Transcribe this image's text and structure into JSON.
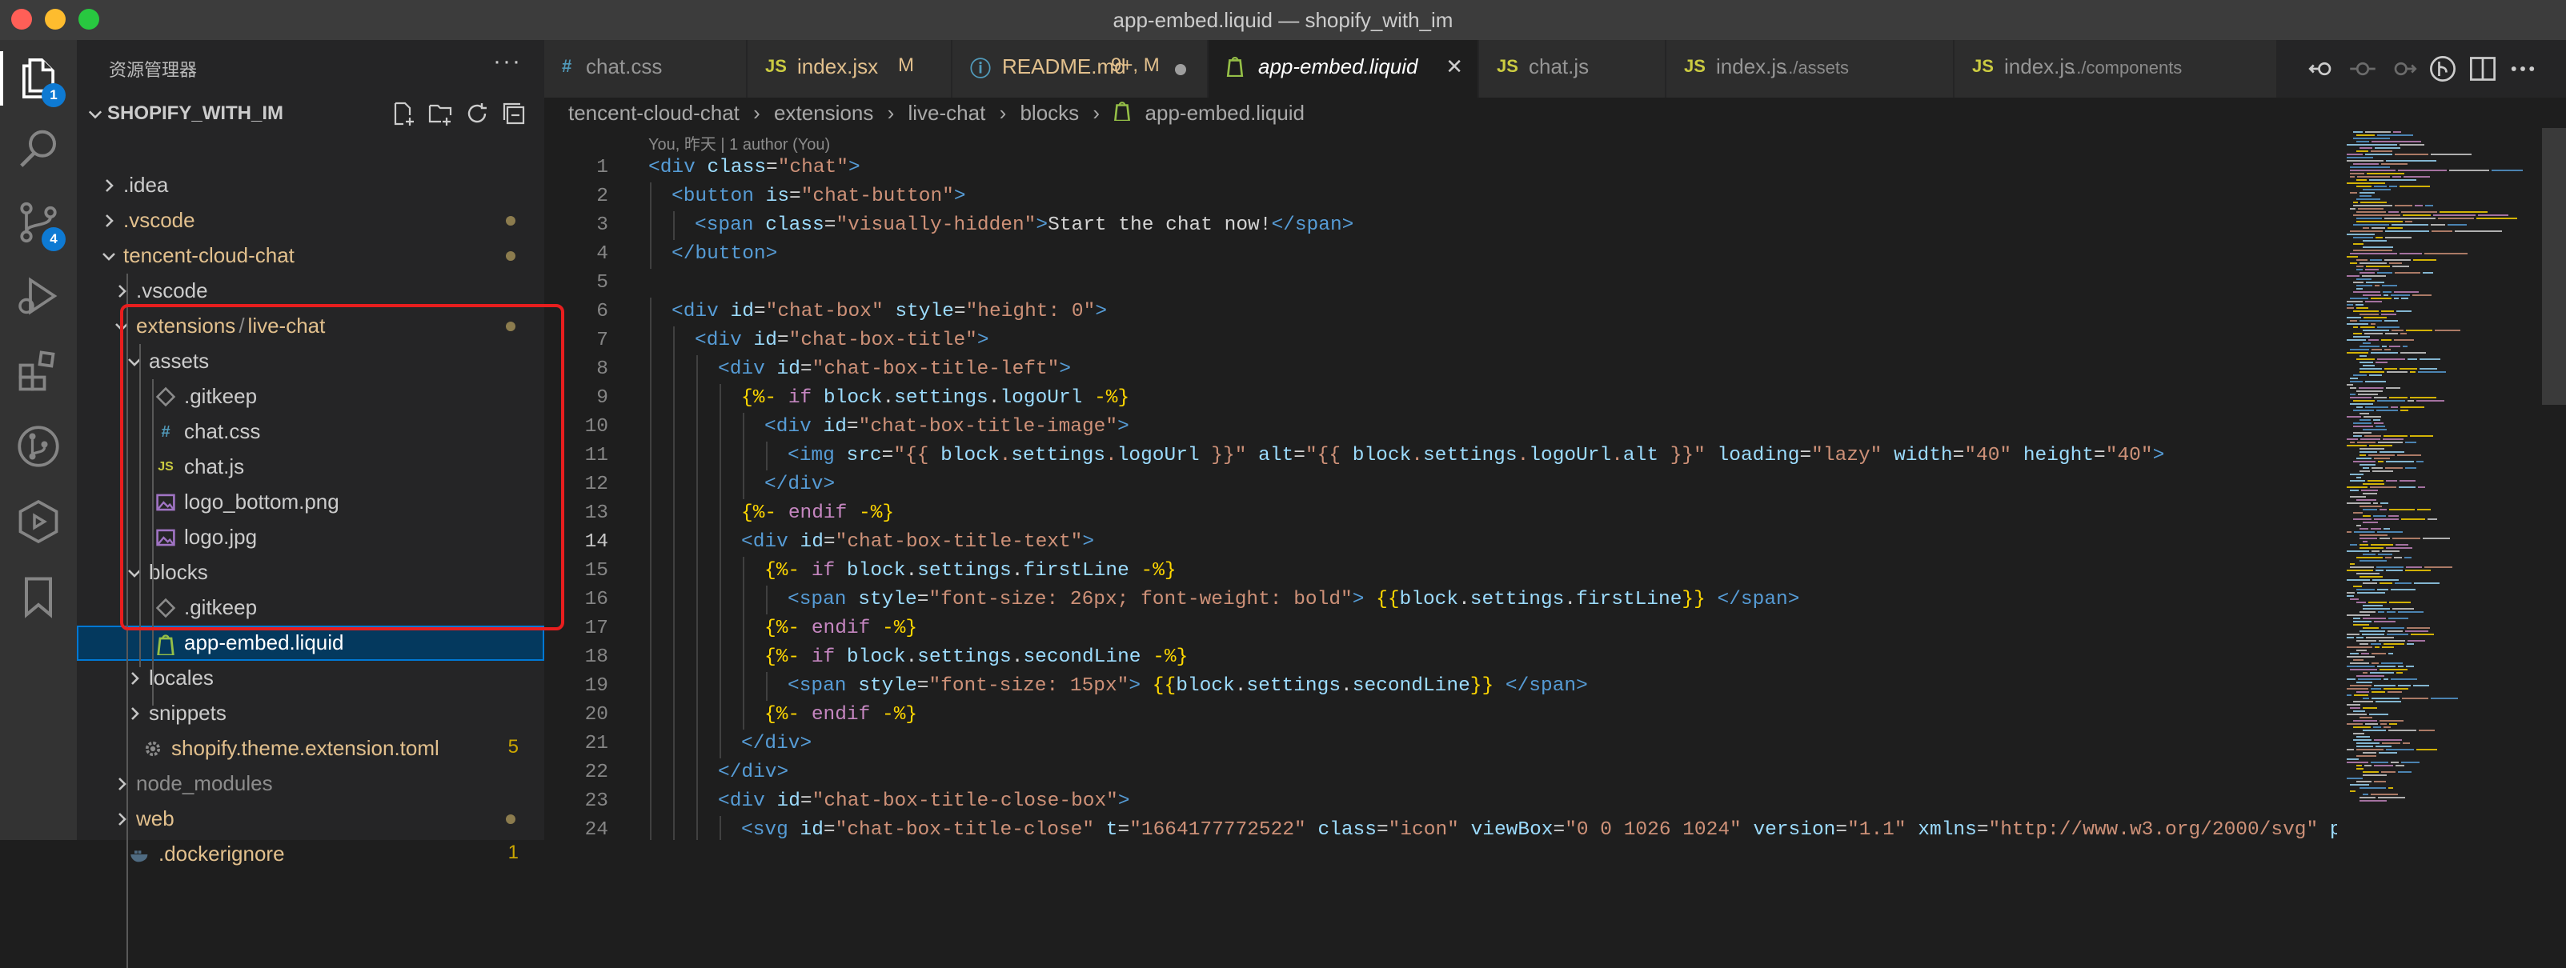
{
  "window": {
    "title": "app-embed.liquid — shopify_with_im"
  },
  "colors": {
    "accent": "#0078d4",
    "highlight_box": "#e81e1e",
    "modified": "#e2c08d",
    "git_dot": "#8c7c4e"
  },
  "activity_bar": {
    "items": [
      {
        "icon": "files-icon",
        "badge": "1"
      },
      {
        "icon": "search-icon"
      },
      {
        "icon": "source-control-icon",
        "badge": "4"
      },
      {
        "icon": "run-debug-icon"
      },
      {
        "icon": "extensions-icon"
      },
      {
        "icon": "git-graph-icon"
      },
      {
        "icon": "remote-explorer-icon"
      },
      {
        "icon": "bookmark-icon"
      }
    ]
  },
  "explorer": {
    "header": "资源管理器",
    "more": "···",
    "project": "SHOPIFY_WITH_IM",
    "tree": [
      {
        "label": ".idea",
        "chev": "right"
      },
      {
        "label": ".vscode",
        "chev": "right",
        "dot": true
      },
      {
        "label": "tencent-cloud-chat",
        "chev": "down",
        "dot": true
      },
      {
        "label": ".vscode",
        "chev": "right"
      },
      {
        "label": "extensions",
        "sep": "/",
        "label2": "live-chat",
        "chev": "down",
        "dot": true
      },
      {
        "label": "assets",
        "chev": "down"
      },
      {
        "label": ".gitkeep",
        "icon": "gitkeep-icon"
      },
      {
        "label": "chat.css",
        "icon": "css-icon",
        "glyph": "#"
      },
      {
        "label": "chat.js",
        "icon": "js-icon",
        "glyph": "JS"
      },
      {
        "label": "logo_bottom.png",
        "icon": "image-icon"
      },
      {
        "label": "logo.jpg",
        "icon": "image-icon"
      },
      {
        "label": "blocks",
        "chev": "down"
      },
      {
        "label": ".gitkeep",
        "icon": "gitkeep-icon"
      },
      {
        "label": "app-embed.liquid",
        "icon": "shopify-icon"
      },
      {
        "label": "locales",
        "chev": "right"
      },
      {
        "label": "snippets",
        "chev": "right"
      },
      {
        "label": "shopify.theme.extension.toml",
        "icon": "gear-icon",
        "count": "5"
      },
      {
        "label": "node_modules",
        "chev": "right"
      },
      {
        "label": "web",
        "chev": "right",
        "dot": true
      },
      {
        "label": ".dockerignore",
        "icon": "docker-icon",
        "count": "1"
      }
    ]
  },
  "tabs": [
    {
      "icon": "css-icon",
      "glyph": "#",
      "label": "chat.css"
    },
    {
      "icon": "js-icon",
      "glyph": "JS",
      "label": "index.jsx",
      "suffix": "M"
    },
    {
      "icon": "info-icon",
      "glyph": "ⓘ",
      "label": "README.md",
      "suffix": "9+, M"
    },
    {
      "icon": "shopify-icon",
      "label": "app-embed.liquid",
      "active": true
    },
    {
      "icon": "js-icon",
      "glyph": "JS",
      "label": "chat.js"
    },
    {
      "icon": "js-icon",
      "glyph": "JS",
      "label": "index.js",
      "suffix": ".../assets"
    },
    {
      "icon": "js-icon",
      "glyph": "JS",
      "label": "index.js",
      "suffix": ".../components"
    }
  ],
  "breadcrumb": [
    "tencent-cloud-chat",
    "extensions",
    "live-chat",
    "blocks",
    "app-embed.liquid"
  ],
  "blame": "You, 昨天 | 1 author (You)",
  "code_lines": [
    [
      [
        "t",
        "<div "
      ],
      [
        "a",
        "class"
      ],
      [
        "p",
        "="
      ],
      [
        "s",
        "\"chat\""
      ],
      [
        "t",
        ">"
      ]
    ],
    [
      [
        "t",
        "<button "
      ],
      [
        "a",
        "is"
      ],
      [
        "p",
        "="
      ],
      [
        "s",
        "\"chat-button\""
      ],
      [
        "t",
        ">"
      ]
    ],
    [
      [
        "t",
        "<span "
      ],
      [
        "a",
        "class"
      ],
      [
        "p",
        "="
      ],
      [
        "s",
        "\"visually-hidden\""
      ],
      [
        "t",
        ">"
      ],
      [
        "p",
        "Start the chat now!"
      ],
      [
        "t",
        "</span>"
      ]
    ],
    [
      [
        "t",
        "</button>"
      ]
    ],
    [],
    [
      [
        "t",
        "<div "
      ],
      [
        "a",
        "id"
      ],
      [
        "p",
        "="
      ],
      [
        "s",
        "\"chat-box\" "
      ],
      [
        "a",
        "style"
      ],
      [
        "p",
        "="
      ],
      [
        "s",
        "\"height: 0\""
      ],
      [
        "t",
        ">"
      ]
    ],
    [
      [
        "t",
        "<div "
      ],
      [
        "a",
        "id"
      ],
      [
        "p",
        "="
      ],
      [
        "s",
        "\"chat-box-title\""
      ],
      [
        "t",
        ">"
      ]
    ],
    [
      [
        "t",
        "<div "
      ],
      [
        "a",
        "id"
      ],
      [
        "p",
        "="
      ],
      [
        "s",
        "\"chat-box-title-left\""
      ],
      [
        "t",
        ">"
      ]
    ],
    [
      [
        "y",
        "{%- "
      ],
      [
        "k",
        "if "
      ],
      [
        "v",
        "block"
      ],
      [
        "p",
        "."
      ],
      [
        "v",
        "settings"
      ],
      [
        "p",
        "."
      ],
      [
        "v",
        "logoUrl "
      ],
      [
        "y",
        "-%}"
      ]
    ],
    [
      [
        "t",
        "<div "
      ],
      [
        "a",
        "id"
      ],
      [
        "p",
        "="
      ],
      [
        "s",
        "\"chat-box-title-image\""
      ],
      [
        "t",
        ">"
      ]
    ],
    [
      [
        "t",
        "<img "
      ],
      [
        "a",
        "src"
      ],
      [
        "p",
        "="
      ],
      [
        "s",
        "\"{{ "
      ],
      [
        "v",
        "block"
      ],
      [
        "s",
        "."
      ],
      [
        "v",
        "settings"
      ],
      [
        "s",
        "."
      ],
      [
        "v",
        "logoUrl"
      ],
      [
        "s",
        " }}\" "
      ],
      [
        "a",
        "alt"
      ],
      [
        "p",
        "="
      ],
      [
        "s",
        "\"{{ "
      ],
      [
        "v",
        "block"
      ],
      [
        "s",
        "."
      ],
      [
        "v",
        "settings"
      ],
      [
        "s",
        "."
      ],
      [
        "v",
        "logoUrl"
      ],
      [
        "s",
        "."
      ],
      [
        "v",
        "alt"
      ],
      [
        "s",
        " }}\" "
      ],
      [
        "a",
        "loading"
      ],
      [
        "p",
        "="
      ],
      [
        "s",
        "\"lazy\" "
      ],
      [
        "a",
        "width"
      ],
      [
        "p",
        "="
      ],
      [
        "s",
        "\"40\" "
      ],
      [
        "a",
        "height"
      ],
      [
        "p",
        "="
      ],
      [
        "s",
        "\"40\""
      ],
      [
        "t",
        ">"
      ]
    ],
    [
      [
        "t",
        "</div>"
      ]
    ],
    [
      [
        "y",
        "{%- "
      ],
      [
        "k",
        "endif "
      ],
      [
        "y",
        "-%}"
      ]
    ],
    [
      [
        "t",
        "<div "
      ],
      [
        "a",
        "id"
      ],
      [
        "p",
        "="
      ],
      [
        "s",
        "\"chat-box-title-text\""
      ],
      [
        "t",
        ">"
      ]
    ],
    [
      [
        "y",
        "{%- "
      ],
      [
        "k",
        "if "
      ],
      [
        "v",
        "block"
      ],
      [
        "p",
        "."
      ],
      [
        "v",
        "settings"
      ],
      [
        "p",
        "."
      ],
      [
        "v",
        "firstLine "
      ],
      [
        "y",
        "-%}"
      ]
    ],
    [
      [
        "t",
        "<span "
      ],
      [
        "a",
        "style"
      ],
      [
        "p",
        "="
      ],
      [
        "s",
        "\"font-size: 26px; font-weight: bold\""
      ],
      [
        "t",
        ">"
      ],
      [
        "y",
        " {{"
      ],
      [
        "v",
        "block"
      ],
      [
        "p",
        "."
      ],
      [
        "v",
        "settings"
      ],
      [
        "p",
        "."
      ],
      [
        "v",
        "firstLine"
      ],
      [
        "y",
        "}}"
      ],
      [
        "t",
        " </span>"
      ]
    ],
    [
      [
        "y",
        "{%- "
      ],
      [
        "k",
        "endif "
      ],
      [
        "y",
        "-%}"
      ]
    ],
    [
      [
        "y",
        "{%- "
      ],
      [
        "k",
        "if "
      ],
      [
        "v",
        "block"
      ],
      [
        "p",
        "."
      ],
      [
        "v",
        "settings"
      ],
      [
        "p",
        "."
      ],
      [
        "v",
        "secondLine "
      ],
      [
        "y",
        "-%}"
      ]
    ],
    [
      [
        "t",
        "<span "
      ],
      [
        "a",
        "style"
      ],
      [
        "p",
        "="
      ],
      [
        "s",
        "\"font-size: 15px\""
      ],
      [
        "t",
        ">"
      ],
      [
        "y",
        " {{"
      ],
      [
        "v",
        "block"
      ],
      [
        "p",
        "."
      ],
      [
        "v",
        "settings"
      ],
      [
        "p",
        "."
      ],
      [
        "v",
        "secondLine"
      ],
      [
        "y",
        "}}"
      ],
      [
        "t",
        " </span>"
      ]
    ],
    [
      [
        "y",
        "{%- "
      ],
      [
        "k",
        "endif "
      ],
      [
        "y",
        "-%}"
      ]
    ],
    [
      [
        "t",
        "</div>"
      ]
    ],
    [
      [
        "t",
        "</div>"
      ]
    ],
    [
      [
        "t",
        "<div "
      ],
      [
        "a",
        "id"
      ],
      [
        "p",
        "="
      ],
      [
        "s",
        "\"chat-box-title-close-box\""
      ],
      [
        "t",
        ">"
      ]
    ],
    [
      [
        "t",
        "<svg "
      ],
      [
        "a",
        "id"
      ],
      [
        "p",
        "="
      ],
      [
        "s",
        "\"chat-box-title-close\" "
      ],
      [
        "a",
        "t"
      ],
      [
        "p",
        "="
      ],
      [
        "s",
        "\"1664177772522\" "
      ],
      [
        "a",
        "class"
      ],
      [
        "p",
        "="
      ],
      [
        "s",
        "\"icon\" "
      ],
      [
        "a",
        "viewBox"
      ],
      [
        "p",
        "="
      ],
      [
        "s",
        "\"0 0 1026 1024\" "
      ],
      [
        "a",
        "version"
      ],
      [
        "p",
        "="
      ],
      [
        "s",
        "\"1.1\" "
      ],
      [
        "a",
        "xmlns"
      ],
      [
        "p",
        "="
      ],
      [
        "s",
        "\"http://www.w3.org/2000/svg\" "
      ],
      [
        "a",
        "p-id"
      ]
    ]
  ],
  "syntax_colors": {
    "t": "#569cd6",
    "a": "#9cdcfe",
    "s": "#ce9178",
    "p": "#d4d4d4",
    "y": "#ffd700",
    "k": "#c586c0",
    "v": "#9cdcfe"
  }
}
